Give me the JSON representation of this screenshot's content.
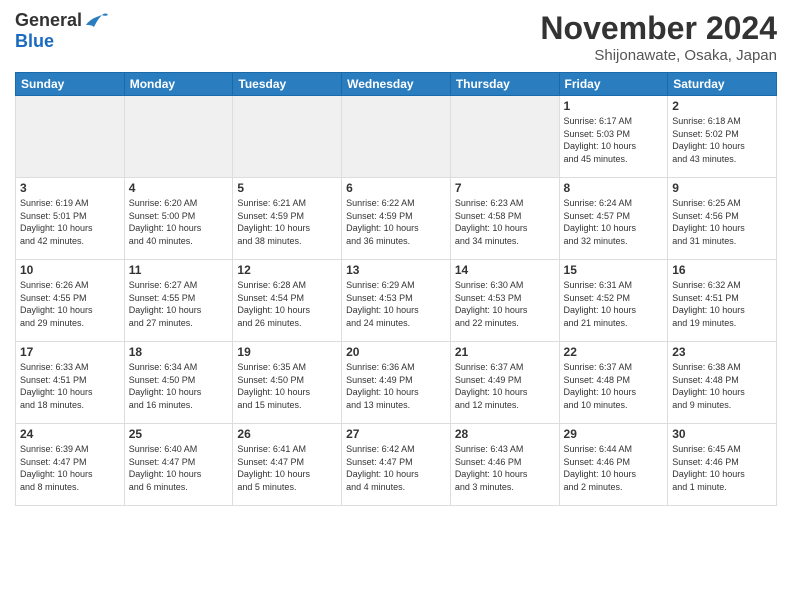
{
  "header": {
    "logo_general": "General",
    "logo_blue": "Blue",
    "month_title": "November 2024",
    "location": "Shijonawate, Osaka, Japan"
  },
  "weekdays": [
    "Sunday",
    "Monday",
    "Tuesday",
    "Wednesday",
    "Thursday",
    "Friday",
    "Saturday"
  ],
  "weeks": [
    [
      {
        "day": "",
        "info": "",
        "empty": true
      },
      {
        "day": "",
        "info": "",
        "empty": true
      },
      {
        "day": "",
        "info": "",
        "empty": true
      },
      {
        "day": "",
        "info": "",
        "empty": true
      },
      {
        "day": "",
        "info": "",
        "empty": true
      },
      {
        "day": "1",
        "info": "Sunrise: 6:17 AM\nSunset: 5:03 PM\nDaylight: 10 hours\nand 45 minutes."
      },
      {
        "day": "2",
        "info": "Sunrise: 6:18 AM\nSunset: 5:02 PM\nDaylight: 10 hours\nand 43 minutes."
      }
    ],
    [
      {
        "day": "3",
        "info": "Sunrise: 6:19 AM\nSunset: 5:01 PM\nDaylight: 10 hours\nand 42 minutes."
      },
      {
        "day": "4",
        "info": "Sunrise: 6:20 AM\nSunset: 5:00 PM\nDaylight: 10 hours\nand 40 minutes."
      },
      {
        "day": "5",
        "info": "Sunrise: 6:21 AM\nSunset: 4:59 PM\nDaylight: 10 hours\nand 38 minutes."
      },
      {
        "day": "6",
        "info": "Sunrise: 6:22 AM\nSunset: 4:59 PM\nDaylight: 10 hours\nand 36 minutes."
      },
      {
        "day": "7",
        "info": "Sunrise: 6:23 AM\nSunset: 4:58 PM\nDaylight: 10 hours\nand 34 minutes."
      },
      {
        "day": "8",
        "info": "Sunrise: 6:24 AM\nSunset: 4:57 PM\nDaylight: 10 hours\nand 32 minutes."
      },
      {
        "day": "9",
        "info": "Sunrise: 6:25 AM\nSunset: 4:56 PM\nDaylight: 10 hours\nand 31 minutes."
      }
    ],
    [
      {
        "day": "10",
        "info": "Sunrise: 6:26 AM\nSunset: 4:55 PM\nDaylight: 10 hours\nand 29 minutes."
      },
      {
        "day": "11",
        "info": "Sunrise: 6:27 AM\nSunset: 4:55 PM\nDaylight: 10 hours\nand 27 minutes."
      },
      {
        "day": "12",
        "info": "Sunrise: 6:28 AM\nSunset: 4:54 PM\nDaylight: 10 hours\nand 26 minutes."
      },
      {
        "day": "13",
        "info": "Sunrise: 6:29 AM\nSunset: 4:53 PM\nDaylight: 10 hours\nand 24 minutes."
      },
      {
        "day": "14",
        "info": "Sunrise: 6:30 AM\nSunset: 4:53 PM\nDaylight: 10 hours\nand 22 minutes."
      },
      {
        "day": "15",
        "info": "Sunrise: 6:31 AM\nSunset: 4:52 PM\nDaylight: 10 hours\nand 21 minutes."
      },
      {
        "day": "16",
        "info": "Sunrise: 6:32 AM\nSunset: 4:51 PM\nDaylight: 10 hours\nand 19 minutes."
      }
    ],
    [
      {
        "day": "17",
        "info": "Sunrise: 6:33 AM\nSunset: 4:51 PM\nDaylight: 10 hours\nand 18 minutes."
      },
      {
        "day": "18",
        "info": "Sunrise: 6:34 AM\nSunset: 4:50 PM\nDaylight: 10 hours\nand 16 minutes."
      },
      {
        "day": "19",
        "info": "Sunrise: 6:35 AM\nSunset: 4:50 PM\nDaylight: 10 hours\nand 15 minutes."
      },
      {
        "day": "20",
        "info": "Sunrise: 6:36 AM\nSunset: 4:49 PM\nDaylight: 10 hours\nand 13 minutes."
      },
      {
        "day": "21",
        "info": "Sunrise: 6:37 AM\nSunset: 4:49 PM\nDaylight: 10 hours\nand 12 minutes."
      },
      {
        "day": "22",
        "info": "Sunrise: 6:37 AM\nSunset: 4:48 PM\nDaylight: 10 hours\nand 10 minutes."
      },
      {
        "day": "23",
        "info": "Sunrise: 6:38 AM\nSunset: 4:48 PM\nDaylight: 10 hours\nand 9 minutes."
      }
    ],
    [
      {
        "day": "24",
        "info": "Sunrise: 6:39 AM\nSunset: 4:47 PM\nDaylight: 10 hours\nand 8 minutes."
      },
      {
        "day": "25",
        "info": "Sunrise: 6:40 AM\nSunset: 4:47 PM\nDaylight: 10 hours\nand 6 minutes."
      },
      {
        "day": "26",
        "info": "Sunrise: 6:41 AM\nSunset: 4:47 PM\nDaylight: 10 hours\nand 5 minutes."
      },
      {
        "day": "27",
        "info": "Sunrise: 6:42 AM\nSunset: 4:47 PM\nDaylight: 10 hours\nand 4 minutes."
      },
      {
        "day": "28",
        "info": "Sunrise: 6:43 AM\nSunset: 4:46 PM\nDaylight: 10 hours\nand 3 minutes."
      },
      {
        "day": "29",
        "info": "Sunrise: 6:44 AM\nSunset: 4:46 PM\nDaylight: 10 hours\nand 2 minutes."
      },
      {
        "day": "30",
        "info": "Sunrise: 6:45 AM\nSunset: 4:46 PM\nDaylight: 10 hours\nand 1 minute."
      }
    ]
  ]
}
